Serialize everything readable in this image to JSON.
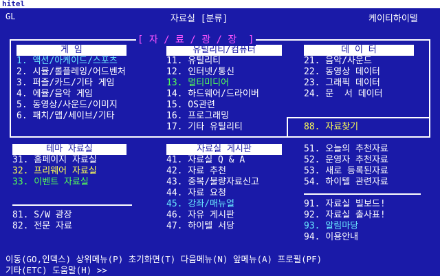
{
  "window": {
    "title": "hitel"
  },
  "status": {
    "left": "GL",
    "center": "자료실 [분류]",
    "right": "케이티하이텔"
  },
  "banner": "[ 자 / 료 / 광 / 장  ]",
  "sections": {
    "games": {
      "header": "게      임",
      "items": [
        {
          "text": "1. 액션/아케이드/스포츠"
        },
        {
          "text": "2. 시뮬/롤플레잉/어드벤처"
        },
        {
          "text": "3. 퍼즐/카드/기타 게임"
        },
        {
          "text": "4. 에뮬/음악 게임"
        },
        {
          "text": "5. 동영상/사운드/이미지"
        },
        {
          "text": "6. 패치/맵/세이브/기타"
        }
      ]
    },
    "utility": {
      "header": "유틸리티/컴퓨터",
      "items": [
        {
          "text": "11. 유틸리티"
        },
        {
          "text": "12. 인터넷/통신"
        },
        {
          "text": "13. 멀티미디어"
        },
        {
          "text": "14. 하드웨어/드라이버"
        },
        {
          "text": "15. OS관련"
        },
        {
          "text": "16. 프로그래밍"
        },
        {
          "text": "17. 기타 유틸리티"
        }
      ]
    },
    "data": {
      "header": "데   이   터",
      "items": [
        {
          "text": "21. 음악/사운드"
        },
        {
          "text": "22. 동영상 데이터"
        },
        {
          "text": "23. 그래픽 데이터"
        },
        {
          "text": "24. 문  서 데이터"
        }
      ]
    },
    "search": {
      "text": "88. 자료찾기"
    },
    "theme": {
      "header": "테마 자료실",
      "items": [
        {
          "text": "31. 홈페이지 자료실"
        },
        {
          "text": "32. 프리웨어 자료실"
        },
        {
          "text": "33. 이벤트 자료실"
        }
      ]
    },
    "board": {
      "header": "자료실 게시판",
      "items": [
        {
          "text": "41. 자료실 Q & A"
        },
        {
          "text": "42. 자료 추천"
        },
        {
          "text": "43. 중복/불량자료신고"
        },
        {
          "text": "44. 자료 요청"
        },
        {
          "text": "45. 강좌/매뉴얼"
        },
        {
          "text": "46. 자유 게시판"
        },
        {
          "text": "47. 하이텔 서당"
        }
      ]
    },
    "recommend": {
      "items": [
        {
          "text": "51. 오늘의 추천자료"
        },
        {
          "text": "52. 운영자 추천자료"
        },
        {
          "text": "53. 새로 등록된자료"
        },
        {
          "text": "54. 하이텔 관련자료"
        }
      ]
    },
    "sw": {
      "items": [
        {
          "text": "81. S/W 광장"
        },
        {
          "text": "82. 전문 자료"
        }
      ]
    },
    "info": {
      "items": [
        {
          "text": "91. 자료실 빌보드!"
        },
        {
          "text": "92. 자료실 출사표!"
        },
        {
          "text": "93. 알림마당"
        },
        {
          "text": "94. 이용안내"
        }
      ]
    }
  },
  "footer": {
    "line1": "이동(GO,인덱스) 상위메뉴(P) 초기화면(T) 다음메뉴(N) 앞메뉴(A) 프로필(PF)",
    "line2": "기타(ETC) 도움말(H) >>"
  },
  "colors": {
    "background": "#1a1aa8",
    "text": "#ffffff",
    "cyan": "#6ae8ff",
    "yellow": "#ffff55",
    "green": "#55ff55",
    "magenta": "#ff55ff"
  }
}
